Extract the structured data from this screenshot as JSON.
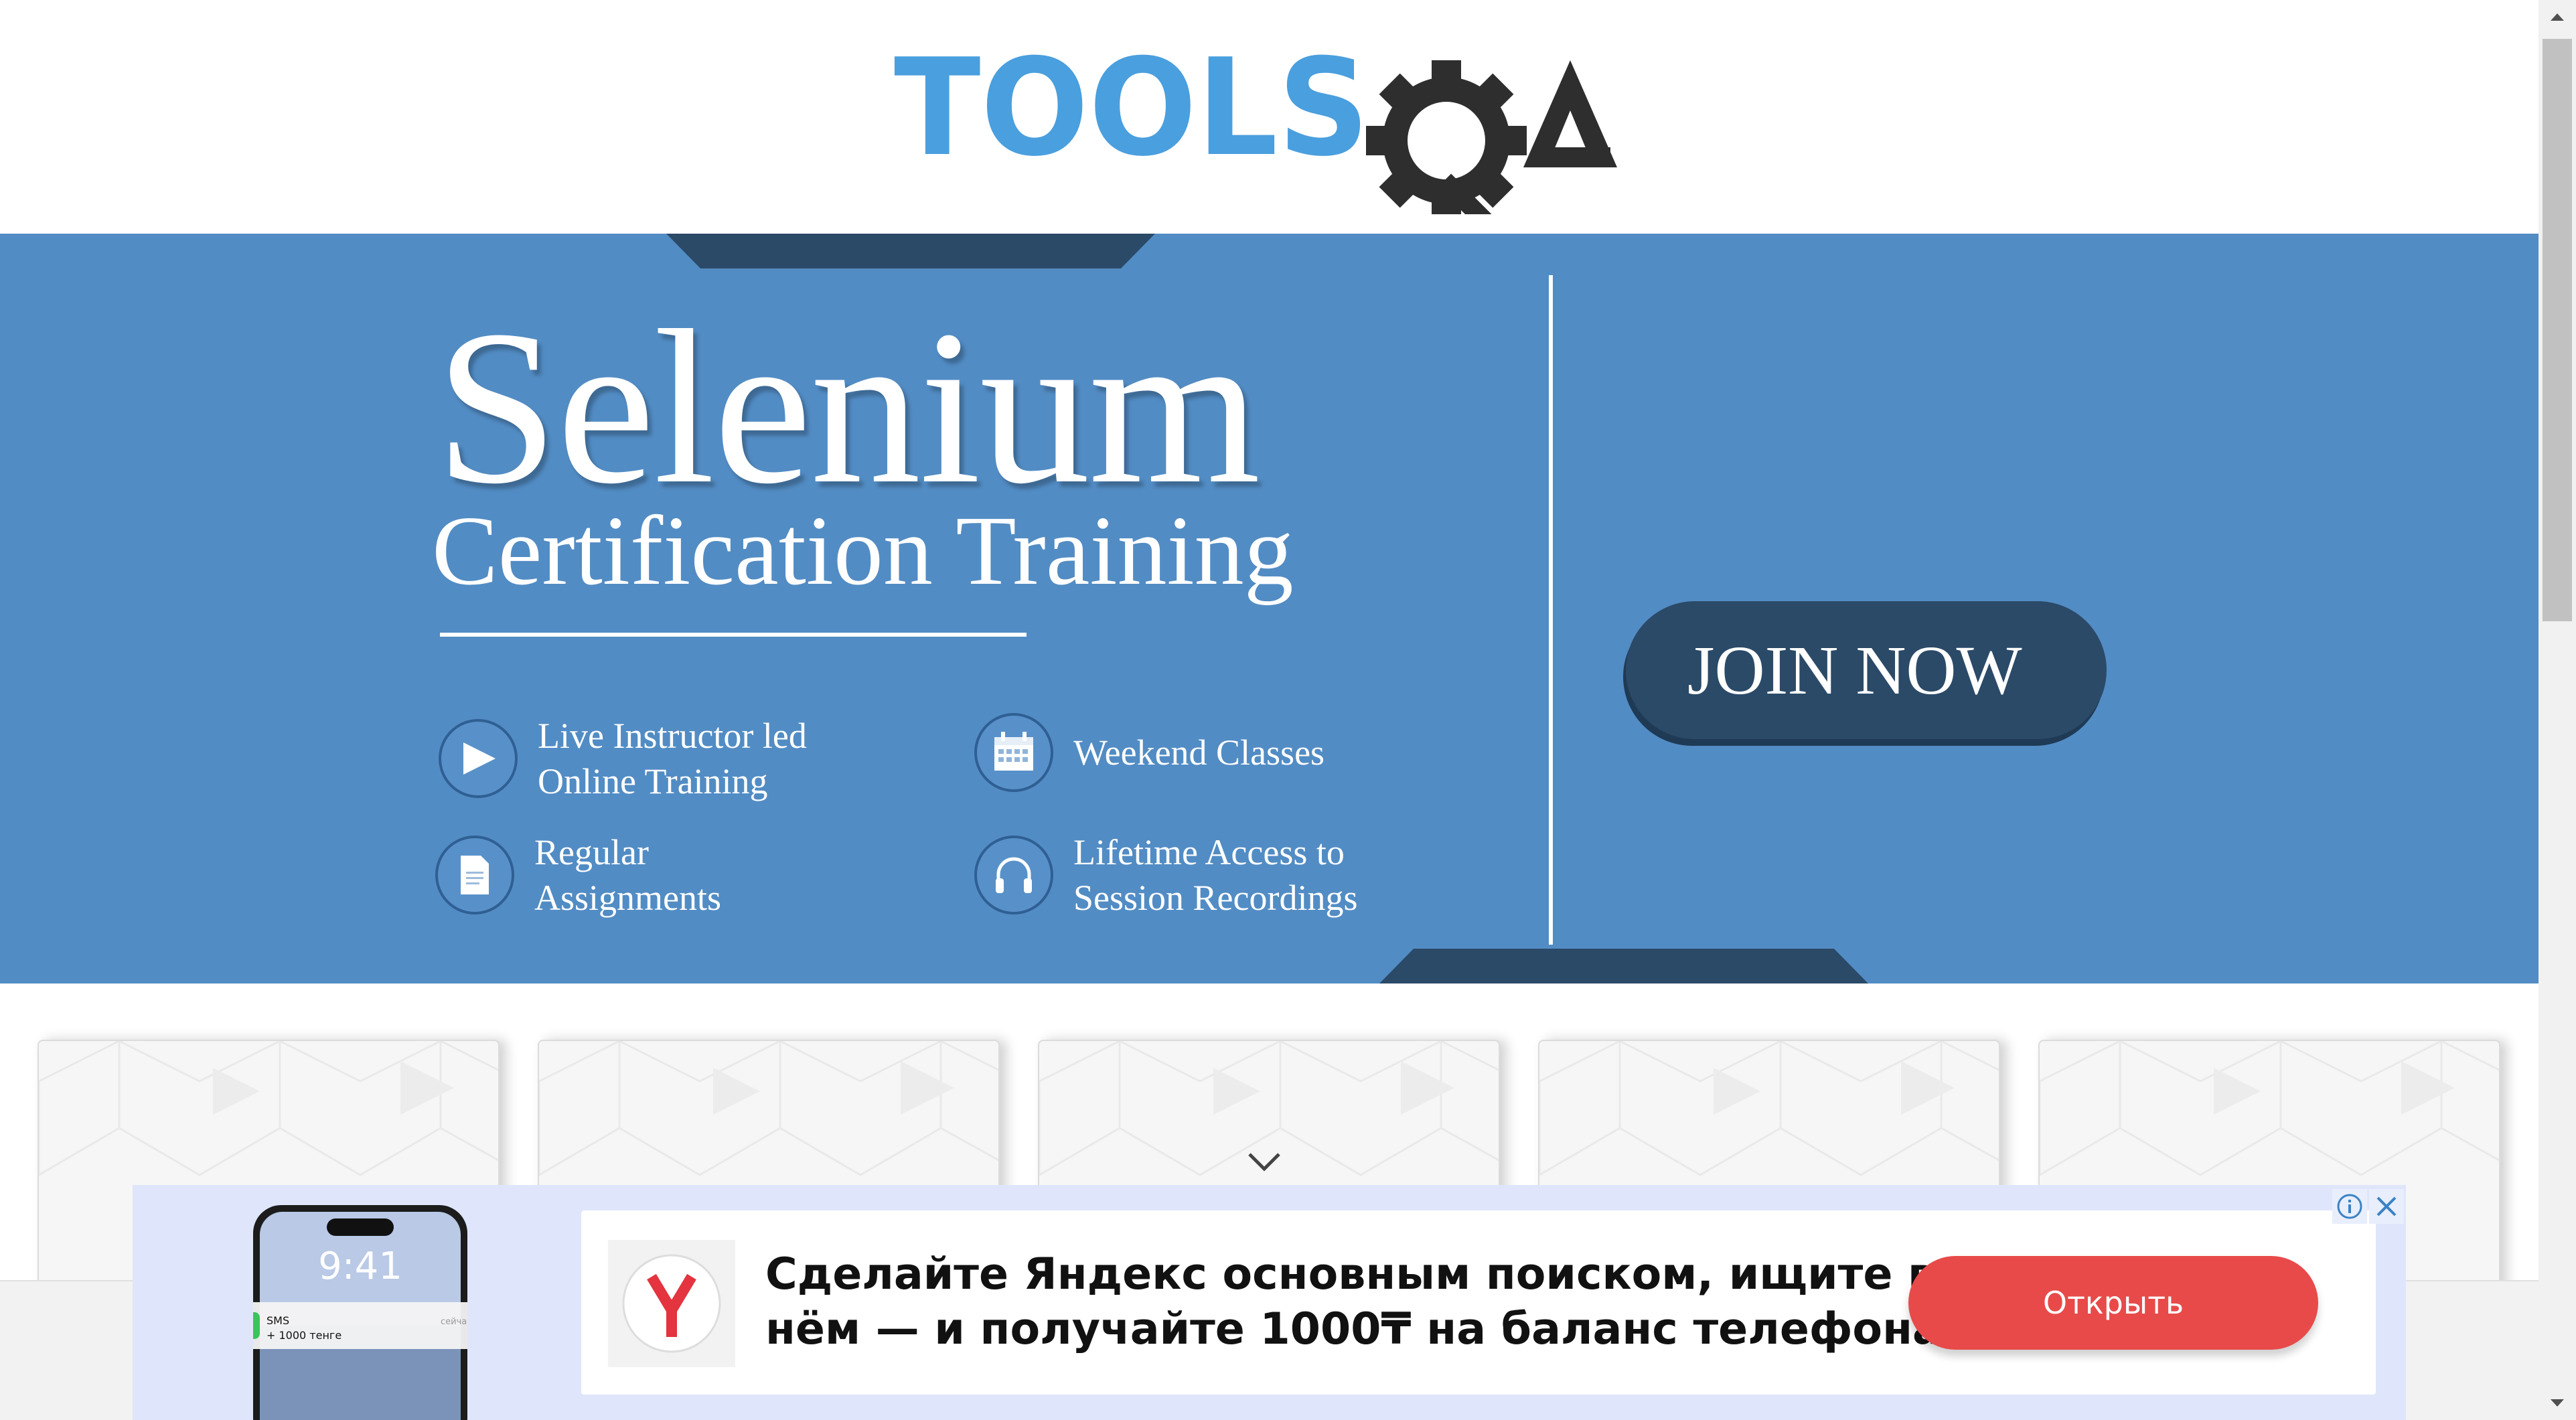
{
  "header": {
    "logo_part1": "TOOLS",
    "logo_part2": "QA",
    "logo_alt": "TOOLSQA"
  },
  "banner": {
    "title": "Selenium",
    "subtitle": "Certification Training",
    "features": [
      {
        "icon": "play-icon",
        "text": "Live Instructor led\nOnline Training"
      },
      {
        "icon": "calendar-icon",
        "text": "Weekend Classes"
      },
      {
        "icon": "document-icon",
        "text": "Regular\nAssignments"
      },
      {
        "icon": "headphones-icon",
        "text": "Lifetime Access to\nSession Recordings"
      }
    ],
    "join_label": "JOIN NOW",
    "colors": {
      "background": "#528cc4",
      "accent": "#2b4a68"
    }
  },
  "cards": {
    "count": 5
  },
  "ad": {
    "headline": "Сделайте Яндекс основным поиском, ищите в нём — и получайте 1000₸ на баланс телефона",
    "button_label": "Открыть",
    "phone_time": "9:41",
    "notification_title": "SMS",
    "notification_text": "+ 1000 тенге",
    "notification_meta": "сейчас",
    "info_icon": "info-icon",
    "close_icon": "close-icon"
  }
}
